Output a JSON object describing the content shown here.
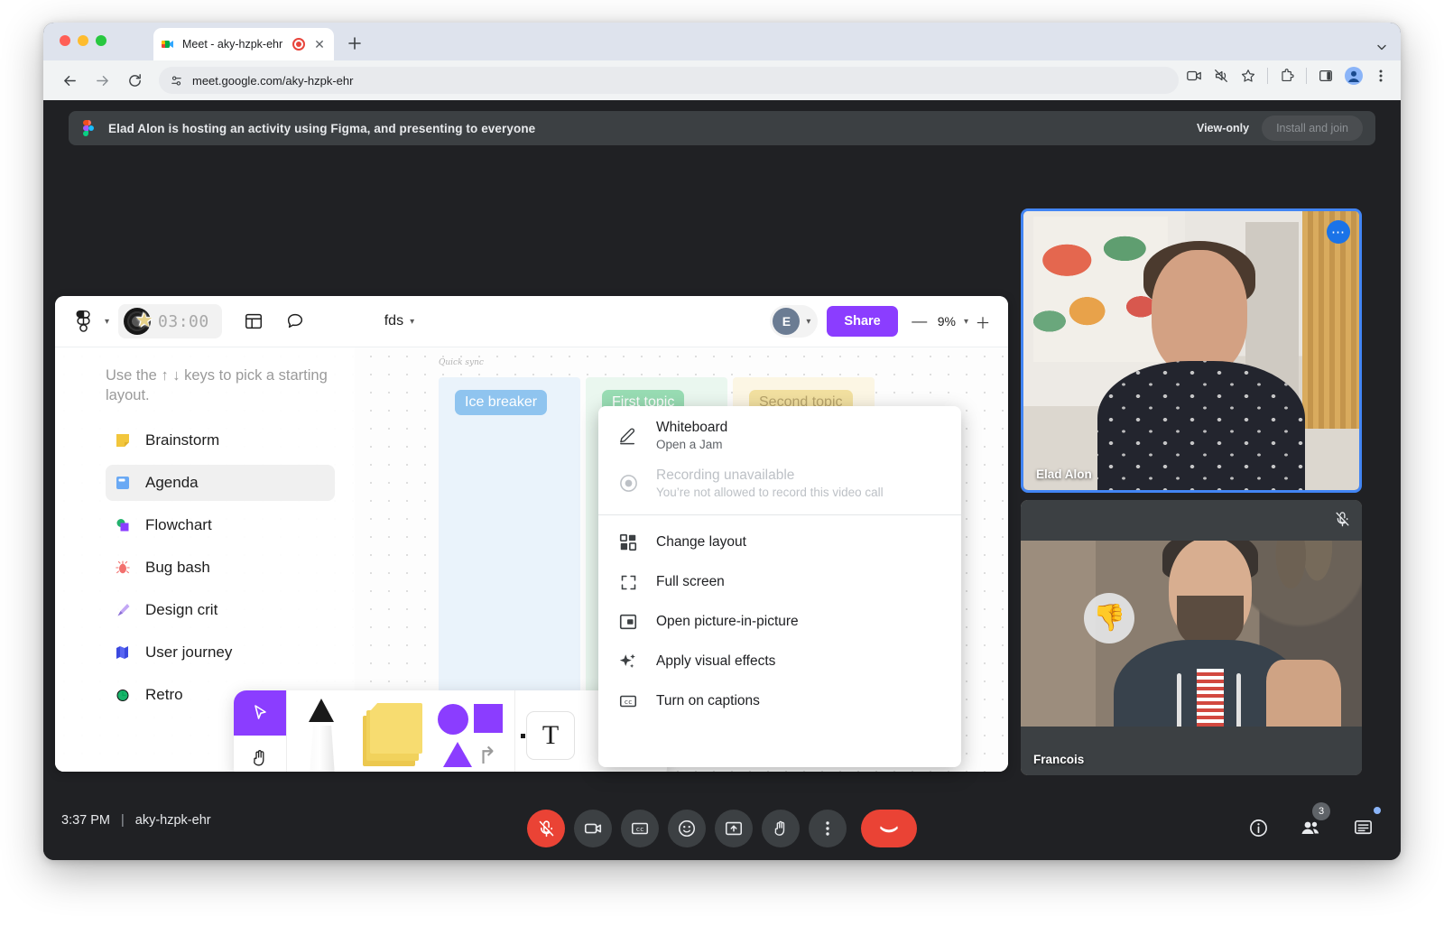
{
  "browser": {
    "tab": {
      "title": "Meet - aky-hzpk-ehr",
      "favicon_icon": "meet-favicon",
      "recording_icon": "recording-indicator-icon",
      "close_icon": "close-icon"
    },
    "new_tab_icon": "plus-icon",
    "tabstrip_menu_icon": "chevron-down-icon",
    "back_icon": "back-arrow-icon",
    "forward_icon": "forward-arrow-icon",
    "reload_icon": "reload-icon",
    "site_info_icon": "site-settings-icon",
    "url": "meet.google.com/aky-hzpk-ehr",
    "toolbar_icons": [
      "screen-share-icon",
      "mute-site-icon",
      "bookmark-star-icon",
      "extensions-puzzle-icon",
      "side-panel-icon",
      "profile-avatar-icon",
      "more-menu-icon"
    ]
  },
  "banner": {
    "app_icon": "figma-icon",
    "text": "Elad Alon is hosting an activity using Figma, and presenting to everyone",
    "view_only_label": "View-only",
    "install_label": "Install and join"
  },
  "figma": {
    "logo_icon": "figma-logo-icon",
    "logo_chevron_icon": "chevron-down-icon",
    "timer": "03:00",
    "timer_icon": "vinyl-record-icon",
    "timer_sticker_icon": "star-sticker-icon",
    "layout_icon": "layout-panels-icon",
    "comment_icon": "comment-bubble-icon",
    "file_name": "fds",
    "file_chevron_icon": "chevron-down-icon",
    "avatar_initial": "E",
    "avatar_chevron_icon": "chevron-down-icon",
    "share_label": "Share",
    "zoom_out_icon": "minus-icon",
    "zoom_level": "9%",
    "zoom_chevron_icon": "chevron-down-icon",
    "zoom_in_icon": "plus-icon",
    "hint": "Use the ↑ ↓ keys to pick a starting layout.",
    "templates": [
      {
        "label": "Brainstorm",
        "icon": "sticky-note-icon",
        "glyph": "▰",
        "selected": false
      },
      {
        "label": "Agenda",
        "icon": "agenda-icon",
        "glyph": "▰",
        "selected": true
      },
      {
        "label": "Flowchart",
        "icon": "flowchart-icon",
        "glyph": "▰",
        "selected": false
      },
      {
        "label": "Bug bash",
        "icon": "bug-icon",
        "glyph": "▰",
        "selected": false
      },
      {
        "label": "Design crit",
        "icon": "pen-nib-icon",
        "glyph": "▰",
        "selected": false
      },
      {
        "label": "User journey",
        "icon": "map-icon",
        "glyph": "▰",
        "selected": false
      },
      {
        "label": "Retro",
        "icon": "clock-icon",
        "glyph": "▰",
        "selected": false
      }
    ],
    "board": {
      "title": "Quick sync",
      "stickies": [
        "Ice breaker",
        "First topic",
        "Second topic"
      ]
    },
    "tools": {
      "move_icon": "cursor-move-icon",
      "hand_icon": "hand-pan-icon",
      "pen_icon": "pen-tool-icon",
      "sticky_icon": "sticky-notes-icon",
      "shapes_icon": "shapes-tool-icon",
      "text_icon": "text-tool-icon"
    },
    "help_label": "?"
  },
  "context_menu": {
    "items": [
      {
        "title": "Whiteboard",
        "subtitle": "Open a Jam",
        "icon": "pencil-icon",
        "disabled": false
      },
      {
        "title": "Recording unavailable",
        "subtitle": "You’re not allowed to record this video call",
        "icon": "record-icon",
        "disabled": true
      },
      {
        "title": "Change layout",
        "subtitle": "",
        "icon": "layout-grid-icon",
        "disabled": false
      },
      {
        "title": "Full screen",
        "subtitle": "",
        "icon": "fullscreen-icon",
        "disabled": false
      },
      {
        "title": "Open picture-in-picture",
        "subtitle": "",
        "icon": "picture-in-picture-icon",
        "disabled": false
      },
      {
        "title": "Apply visual effects",
        "subtitle": "",
        "icon": "sparkles-icon",
        "disabled": false
      },
      {
        "title": "Turn on captions",
        "subtitle": "",
        "icon": "closed-captions-icon",
        "disabled": false
      }
    ]
  },
  "participants": [
    {
      "name": "Elad Alon",
      "more_icon": "more-options-icon",
      "muted": false,
      "speaking_border": "#4285f4"
    },
    {
      "name": "Francois",
      "mute_icon": "mic-off-icon",
      "muted": true,
      "reaction_icon": "thumbs-down-reaction"
    }
  ],
  "meet_bar": {
    "time": "3:37 PM",
    "separator": "|",
    "meeting_code": "aky-hzpk-ehr",
    "controls": [
      {
        "name": "microphone",
        "icon": "mic-off-icon",
        "state": "muted"
      },
      {
        "name": "camera",
        "icon": "camera-icon",
        "state": "on"
      },
      {
        "name": "captions",
        "icon": "closed-captions-icon",
        "state": "off"
      },
      {
        "name": "reactions",
        "icon": "emoji-smile-icon",
        "state": "off"
      },
      {
        "name": "present",
        "icon": "present-screen-icon",
        "state": "off"
      },
      {
        "name": "raise-hand",
        "icon": "raise-hand-icon",
        "state": "off"
      },
      {
        "name": "more-options",
        "icon": "more-vertical-icon",
        "state": "off"
      },
      {
        "name": "leave-call",
        "icon": "hang-up-icon",
        "state": "danger"
      }
    ],
    "right": [
      {
        "name": "meeting-details",
        "icon": "info-icon",
        "badge": ""
      },
      {
        "name": "people",
        "icon": "people-icon",
        "badge": "3"
      },
      {
        "name": "chat",
        "icon": "chat-icon",
        "badge": ""
      }
    ]
  },
  "colors": {
    "accent_blue": "#4285f4",
    "danger_red": "#ea4335",
    "figma_purple": "#8b3dff",
    "meet_dark": "#202124",
    "surface_dark": "#3c4043"
  }
}
